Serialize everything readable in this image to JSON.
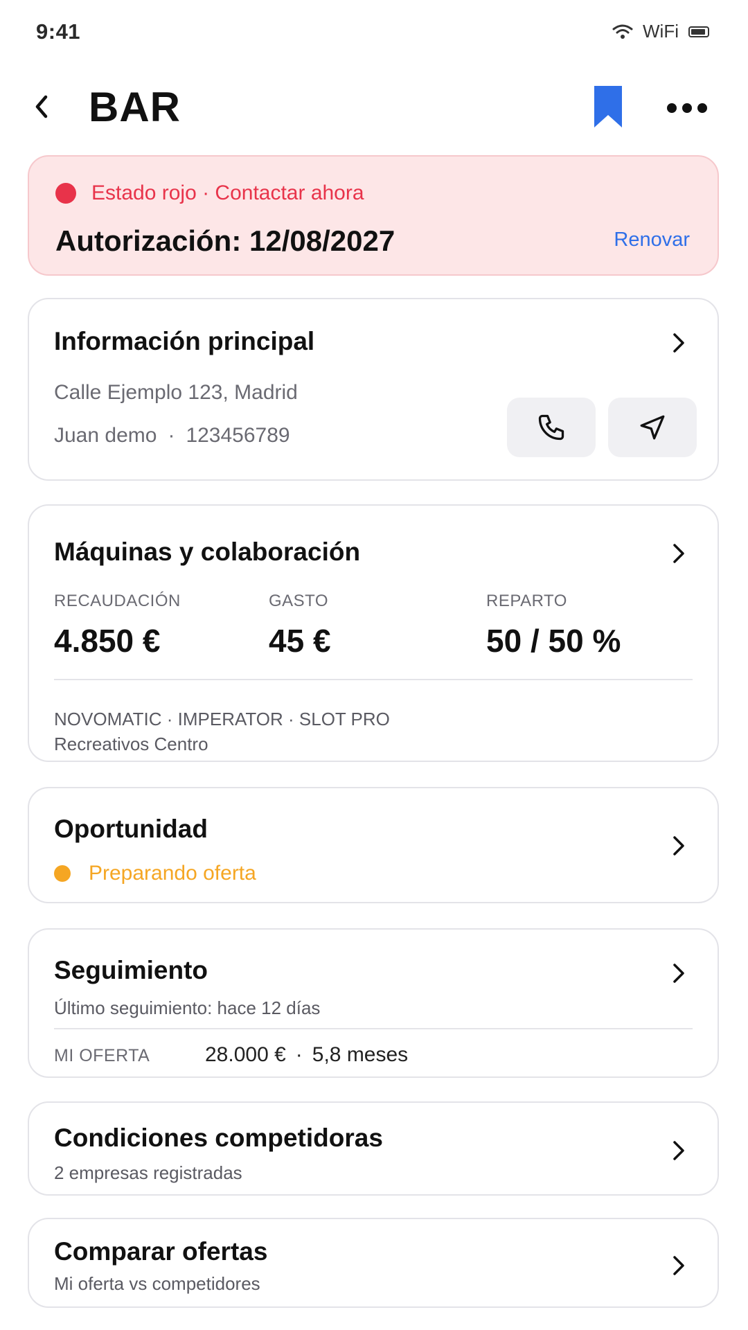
{
  "status_bar": {
    "time": "9:41",
    "wifi_label": "WiFi"
  },
  "header": {
    "title": "BAR"
  },
  "alert": {
    "status_text": "Estado rojo · Contactar ahora",
    "authorization": "Autorización: 12/08/2027",
    "renew_label": "Renovar"
  },
  "info": {
    "title": "Información principal",
    "address": "Calle Ejemplo 123, Madrid",
    "contact_name": "Juan demo",
    "separator": "·",
    "phone": "123456789"
  },
  "machines": {
    "title": "Máquinas y colaboración",
    "metrics": [
      {
        "label": "RECAUDACIÓN",
        "value": "4.850 €"
      },
      {
        "label": "GASTO",
        "value": "45 €"
      },
      {
        "label": "REPARTO",
        "value": "50 / 50 %"
      }
    ],
    "brands": "NOVOMATIC · IMPERATOR · SLOT PRO",
    "operator": "Recreativos Centro"
  },
  "opportunity": {
    "title": "Oportunidad",
    "status": "Preparando oferta"
  },
  "follow_up": {
    "title": "Seguimiento",
    "last": "Último seguimiento: hace 12 días",
    "offer_label": "MI OFERTA",
    "offer_amount": "28.000 €",
    "separator": "·",
    "offer_duration": "5,8 meses"
  },
  "competitors": {
    "title": "Condiciones competidoras",
    "subtitle": "2 empresas registradas"
  },
  "compare": {
    "title": "Comparar ofertas",
    "subtitle": "Mi oferta vs competidores"
  },
  "colors": {
    "accent": "#2f6fe8",
    "danger": "#e8334a",
    "warning": "#f5a623",
    "alert_bg": "#fde6e7"
  },
  "icons": [
    "chevron-left-icon",
    "bookmark-icon",
    "more-icon",
    "phone-icon",
    "navigation-icon",
    "chevron-right-icon",
    "wifi-icon",
    "battery-icon"
  ]
}
